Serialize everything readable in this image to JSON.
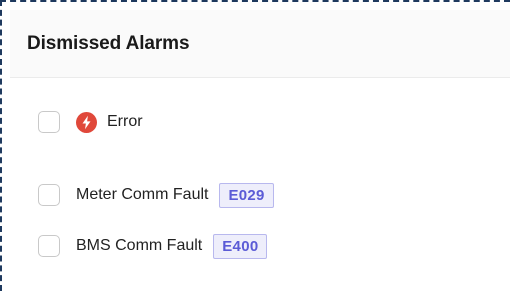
{
  "panel": {
    "title": "Dismissed Alarms"
  },
  "alarms": [
    {
      "label": "Error",
      "icon": "error-bolt-icon",
      "icon_color": "#e0483a",
      "checked": false
    },
    {
      "label": "Meter Comm Fault",
      "code": "E029",
      "checked": false
    },
    {
      "label": "BMS Comm Fault",
      "code": "E400",
      "checked": false
    }
  ],
  "colors": {
    "tag_text": "#5b5bd6",
    "tag_bg": "#eeeefb",
    "frame_border": "#1f3a5f"
  }
}
